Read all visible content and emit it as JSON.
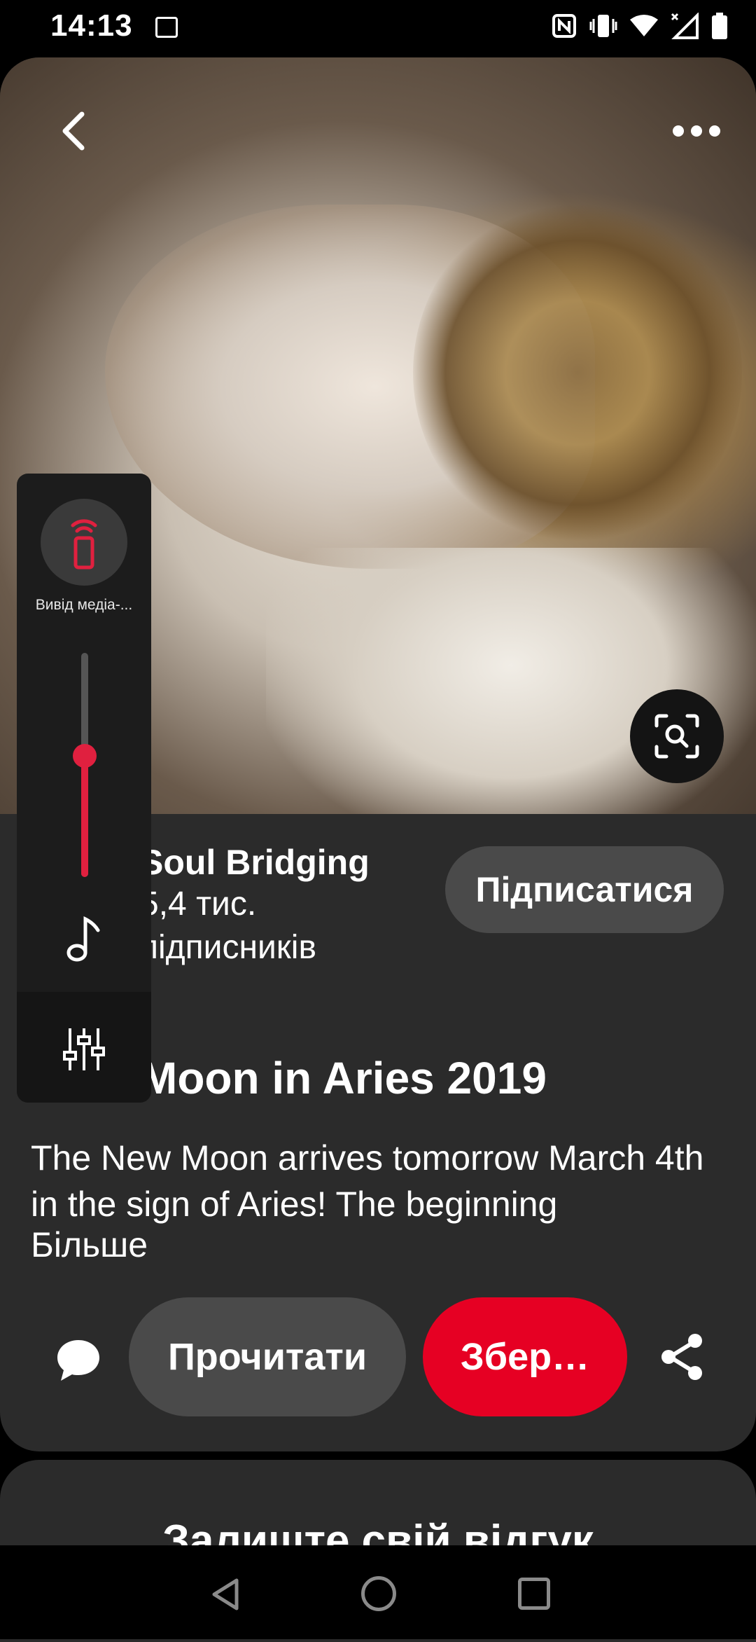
{
  "status_bar": {
    "time": "14:13",
    "icons": [
      "image-icon",
      "nfc-icon",
      "vibrate-icon",
      "wifi-icon",
      "signal-icon",
      "battery-icon"
    ]
  },
  "pin": {
    "creator_name": "Soul Bridging",
    "followers": "5,4 тис. підписників",
    "subscribe_label": "Підписатися",
    "title": "Moon in Aries 2019",
    "description": "The New Moon arrives tomorrow March 4th in the sign of Aries! The beginning",
    "more_label": "Більше",
    "read_label": "Прочитати",
    "save_label": "Збер…",
    "accent_color": "#e60023"
  },
  "feedback": {
    "title": "Залиште свій відгук"
  },
  "volume_panel": {
    "output_label": "Вивід медіа-...",
    "level_fraction": 0.54
  }
}
